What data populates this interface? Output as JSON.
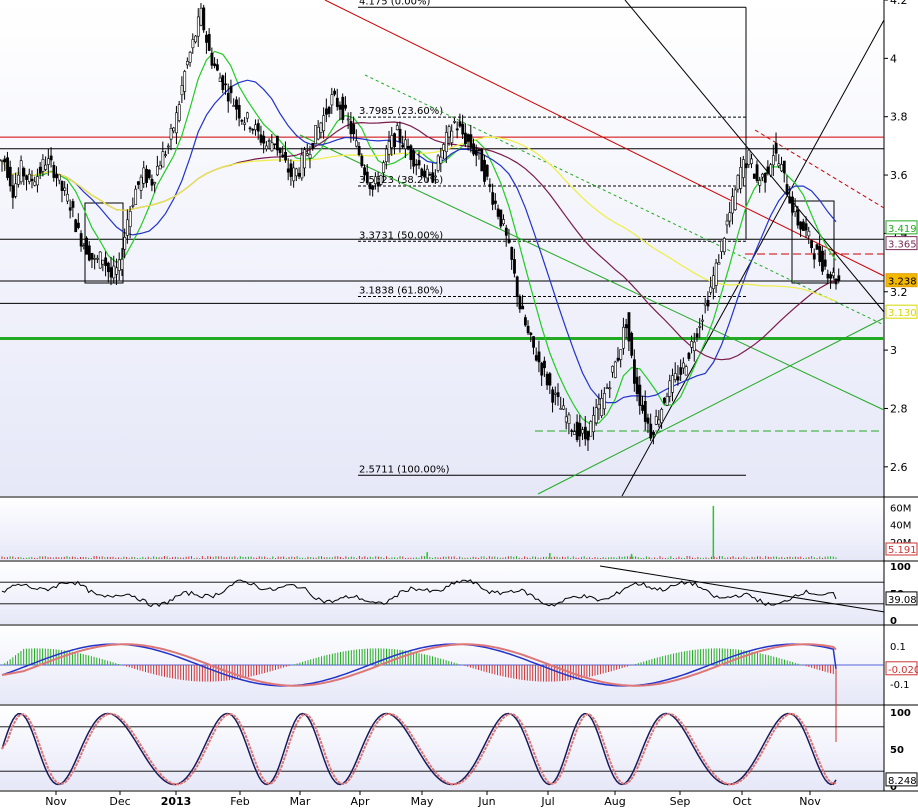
{
  "chart_data": {
    "type": "candlestick",
    "months": [
      "Nov",
      "Dec",
      "2013",
      "Feb",
      "Mar",
      "Apr",
      "May",
      "Jun",
      "Jul",
      "Aug",
      "Sep",
      "Oct",
      "Nov"
    ],
    "price": {
      "ylim": [
        2.5,
        4.2
      ],
      "ticks": [
        2.6,
        2.8,
        3,
        3.2,
        3.4,
        3.6,
        3.8,
        4,
        4.2
      ],
      "tick_labels": [
        "2.6",
        "2.8",
        "3",
        "3.2",
        "3.4",
        "3.6",
        "3.8",
        "4",
        "4.2"
      ],
      "fib_levels": [
        {
          "value": 4.175,
          "label": "4.175 (0.00%)"
        },
        {
          "value": 3.7985,
          "label": "3.7985 (23.60%)"
        },
        {
          "value": 3.5623,
          "label": "3.5623 (38.20%)"
        },
        {
          "value": 3.3731,
          "label": "3.3731 (50.00%)"
        },
        {
          "value": 3.1838,
          "label": "3.1838 (61.80%)"
        },
        {
          "value": 2.5711,
          "label": "2.5711 (100.00%)"
        }
      ],
      "value_tags": [
        {
          "label": "3.419",
          "value": 3.419,
          "color": "#1faa1f"
        },
        {
          "label": "3.365",
          "value": 3.365,
          "color": "#7a2a5a"
        },
        {
          "label": "3.238",
          "value": 3.238,
          "color": "#e0a000"
        },
        {
          "label": "3.130",
          "value": 3.13,
          "color": "#d8d800"
        }
      ],
      "horizontal_levels": [
        {
          "value": 3.73,
          "color": "#d00000"
        },
        {
          "value": 3.69,
          "color": "#000000"
        },
        {
          "value": 3.38,
          "color": "#000000"
        },
        {
          "value": 3.237,
          "color": "#000000"
        },
        {
          "value": 3.16,
          "color": "#000000"
        },
        {
          "value": 3.04,
          "color": "#22aa22"
        }
      ],
      "closes": [
        3.65,
        3.55,
        3.62,
        3.58,
        3.6,
        3.65,
        3.62,
        3.55,
        3.5,
        3.4,
        3.35,
        3.3,
        3.32,
        3.25,
        3.28,
        3.45,
        3.55,
        3.6,
        3.58,
        3.65,
        3.7,
        3.8,
        3.95,
        4.05,
        4.15,
        4.02,
        3.95,
        3.9,
        3.85,
        3.8,
        3.78,
        3.74,
        3.7,
        3.72,
        3.65,
        3.6,
        3.62,
        3.68,
        3.74,
        3.8,
        3.86,
        3.84,
        3.78,
        3.7,
        3.62,
        3.55,
        3.6,
        3.7,
        3.74,
        3.7,
        3.66,
        3.62,
        3.58,
        3.64,
        3.72,
        3.78,
        3.74,
        3.7,
        3.66,
        3.58,
        3.5,
        3.42,
        3.3,
        3.15,
        3.05,
        2.98,
        2.92,
        2.85,
        2.8,
        2.75,
        2.72,
        2.7,
        2.76,
        2.82,
        2.9,
        2.98,
        3.1,
        2.9,
        2.8,
        2.72,
        2.78,
        2.86,
        2.9,
        2.94,
        3.02,
        3.1,
        3.18,
        3.28,
        3.4,
        3.5,
        3.62,
        3.66,
        3.58,
        3.6,
        3.68,
        3.62,
        3.52,
        3.44,
        3.4,
        3.34,
        3.3,
        3.26,
        3.238
      ]
    },
    "volume": {
      "ticks": [
        "60M",
        "40M",
        "20M"
      ],
      "last_label": "5.191",
      "spikes": [
        {
          "index": 87,
          "value": 62
        },
        {
          "index": 52,
          "value": 8
        },
        {
          "index": 67,
          "value": 7
        },
        {
          "index": 77,
          "value": 6
        }
      ]
    },
    "rsi": {
      "ticks": [
        "100",
        "50",
        "0"
      ],
      "levels": [
        70,
        30
      ],
      "last_label": "39.08"
    },
    "macd": {
      "ticks": [
        "0.1",
        "-0.1"
      ],
      "last_label": "-0.020"
    },
    "stochastic": {
      "ticks": [
        "100",
        "50",
        "0"
      ],
      "levels": [
        80,
        20
      ],
      "last_label": "8.248"
    },
    "colors": {
      "ma_fast": "#22cc22",
      "ma_mid": "#2233cc",
      "ma_slow": "#7a1a4a",
      "ma_long": "#eeee44",
      "trend_red": "#d00000",
      "macd_hist": "#cc3333"
    }
  }
}
